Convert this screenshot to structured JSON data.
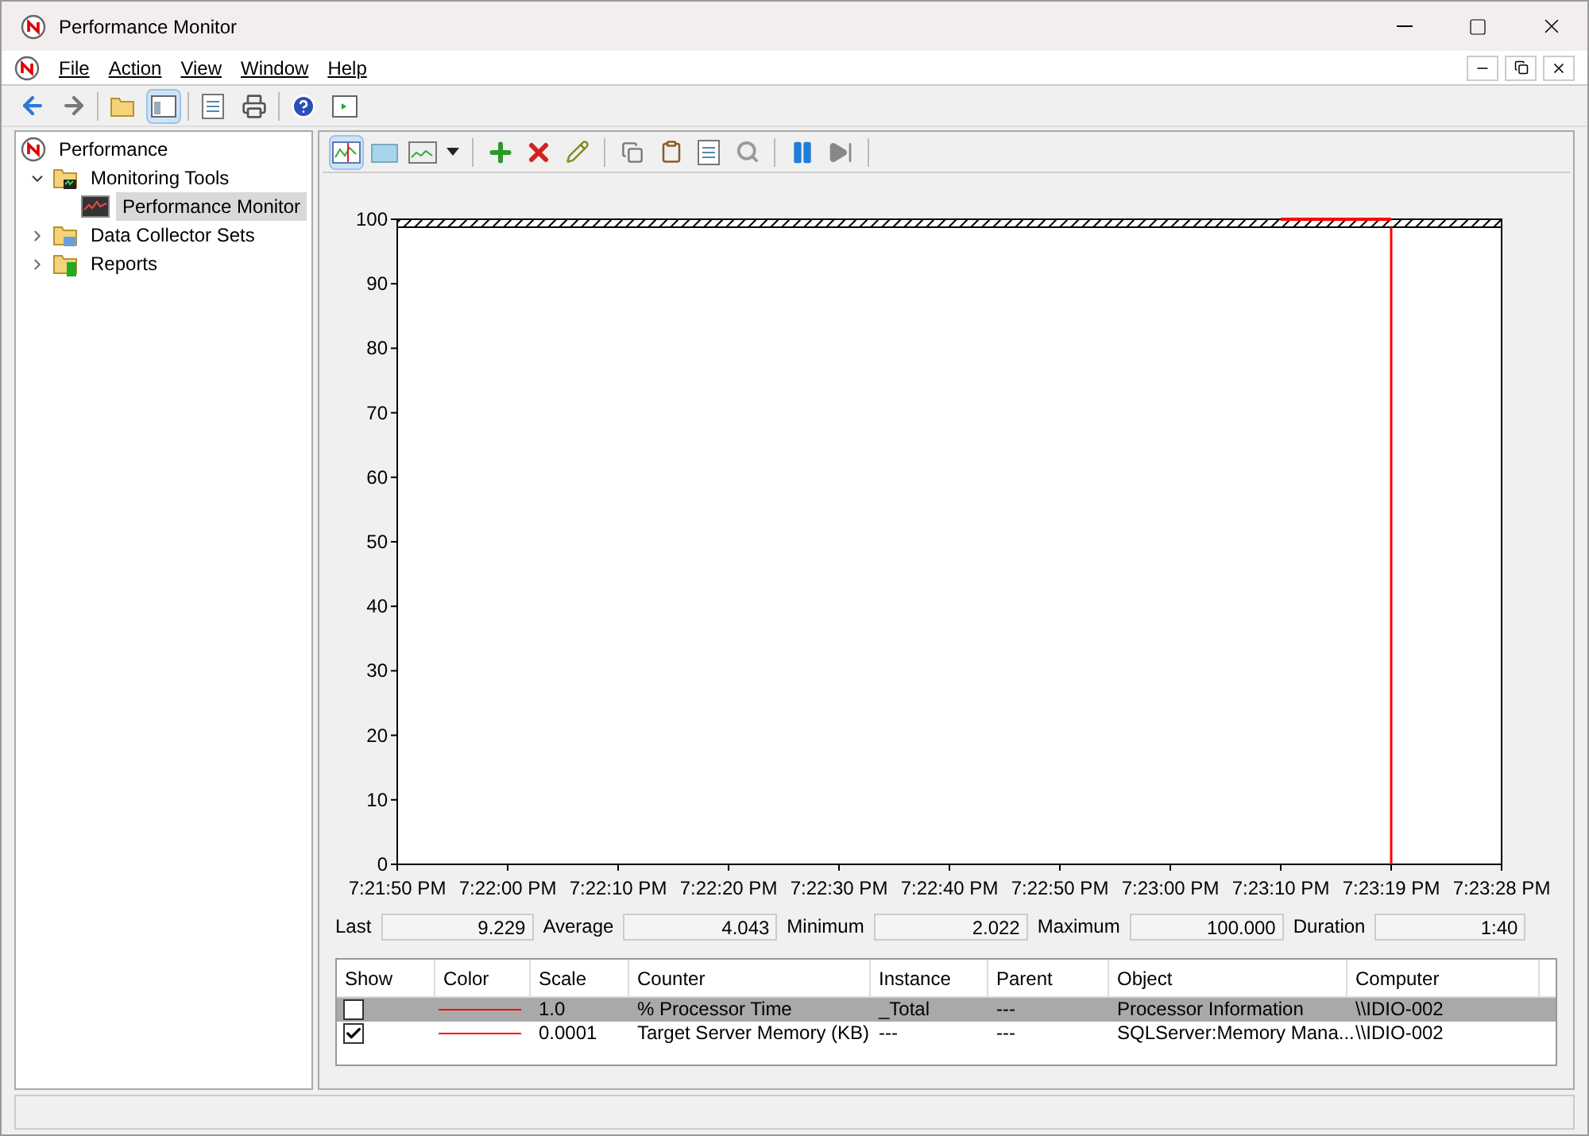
{
  "window": {
    "title": "Performance Monitor"
  },
  "menu": [
    "File",
    "Action",
    "View",
    "Window",
    "Help"
  ],
  "tree": [
    {
      "label": "Performance",
      "kind": "root",
      "selected": false,
      "children": [
        {
          "label": "Monitoring Tools",
          "kind": "folder",
          "selected": false,
          "expanded": true,
          "children": [
            {
              "label": "Performance Monitor",
              "kind": "monitor",
              "selected": true
            }
          ]
        },
        {
          "label": "Data Collector Sets",
          "kind": "collector",
          "selected": false,
          "expanded": false
        },
        {
          "label": "Reports",
          "kind": "reports",
          "selected": false,
          "expanded": false
        }
      ]
    }
  ],
  "chart": {
    "chart_data": {
      "type": "line",
      "ylim": [
        0,
        100
      ],
      "yticks": [
        0,
        10,
        20,
        30,
        40,
        50,
        60,
        70,
        80,
        90,
        100
      ],
      "categories": [
        "7:21:50 PM",
        "7:22:00 PM",
        "7:22:10 PM",
        "7:22:20 PM",
        "7:22:30 PM",
        "7:22:40 PM",
        "7:22:50 PM",
        "7:23:00 PM",
        "7:23:10 PM",
        "7:23:19 PM",
        "7:23:28 PM"
      ],
      "series": [
        {
          "color": "#ff0000",
          "values": [
            null,
            null,
            null,
            null,
            null,
            null,
            null,
            null,
            100,
            100,
            null
          ]
        }
      ]
    }
  },
  "stats": [
    {
      "label": "Last",
      "value": "9.229"
    },
    {
      "label": "Average",
      "value": "4.043"
    },
    {
      "label": "Minimum",
      "value": "2.022"
    },
    {
      "label": "Maximum",
      "value": "100.000"
    },
    {
      "label": "Duration",
      "value": "1:40"
    }
  ],
  "counters": {
    "columns": [
      "Show",
      "Color",
      "Scale",
      "Counter",
      "Instance",
      "Parent",
      "Object",
      "Computer"
    ],
    "rows": [
      {
        "show": false,
        "selected": true,
        "color": "#ff0000",
        "scale": "1.0",
        "counter": "% Processor Time",
        "instance": "_Total",
        "parent": "---",
        "object": "Processor Information",
        "computer": "\\\\IDIO-002"
      },
      {
        "show": true,
        "selected": false,
        "color": "#ff0000",
        "scale": "0.0001",
        "counter": "Target Server Memory (KB)",
        "instance": "---",
        "parent": "---",
        "object": "SQLServer:Memory Mana...",
        "computer": "\\\\IDIO-002"
      }
    ]
  }
}
